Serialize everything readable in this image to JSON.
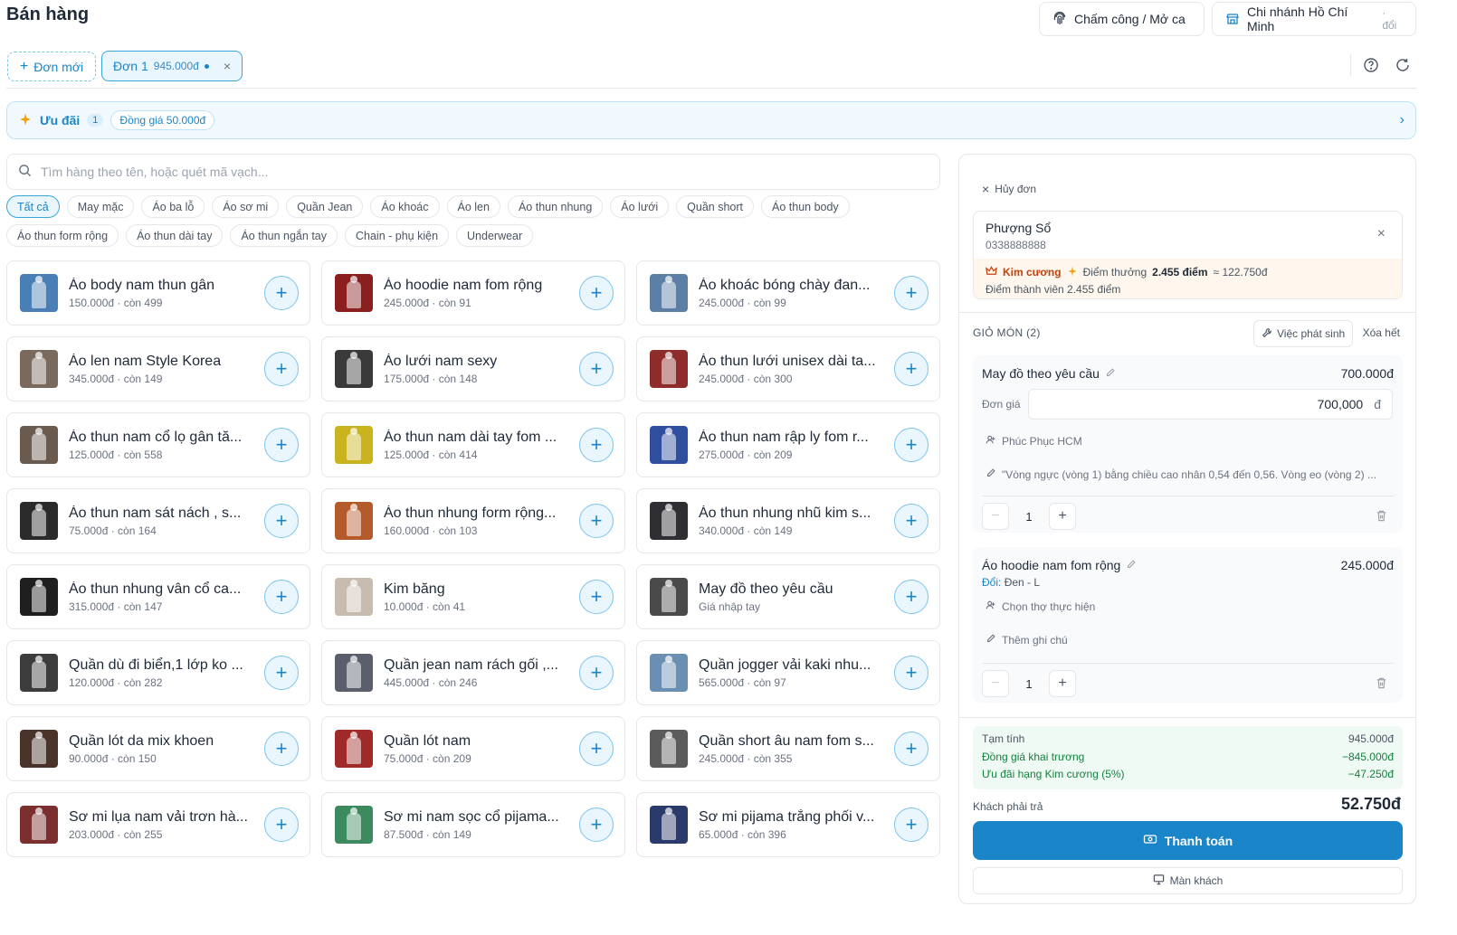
{
  "header": {
    "title": "Bán hàng",
    "attendance_label": "Chấm công / Mở ca",
    "branch_label": "Chi nhánh Hồ Chí Minh",
    "branch_change": "· đổi"
  },
  "orders": {
    "new_label": "Đơn mới",
    "tabs": [
      {
        "label": "Đơn 1",
        "amount": "945.000đ"
      }
    ]
  },
  "promo": {
    "label": "Ưu đãi",
    "count": "1",
    "chip": "Đồng giá 50.000đ"
  },
  "search": {
    "placeholder": "Tìm hàng theo tên, hoặc quét mã vạch..."
  },
  "categories": [
    "Tất cả",
    "May mặc",
    "Áo ba lỗ",
    "Áo sơ mi",
    "Quần Jean",
    "Áo khoác",
    "Áo len",
    "Áo thun nhung",
    "Áo lưới",
    "Quần short",
    "Áo thun body",
    "Áo thun form rộng",
    "Áo thun dài tay",
    "Áo thun ngắn tay",
    "Chain - phụ kiện",
    "Underwear"
  ],
  "active_category": 0,
  "products": [
    {
      "name": "Áo body nam thun gân",
      "meta": "150.000đ · còn 499",
      "thumb": "#4a7fb5"
    },
    {
      "name": "Áo hoodie nam fom rộng",
      "meta": "245.000đ · còn 91",
      "thumb": "#8b1e1e"
    },
    {
      "name": "Áo khoác bóng chày đan...",
      "meta": "245.000đ · còn 99",
      "thumb": "#5b7fa6"
    },
    {
      "name": "Áo len nam Style Korea",
      "meta": "345.000đ · còn 149",
      "thumb": "#7a6a5e"
    },
    {
      "name": "Áo lưới nam sexy",
      "meta": "175.000đ · còn 148",
      "thumb": "#3a3a3a"
    },
    {
      "name": "Áo thun lưới unisex dài ta...",
      "meta": "245.000đ · còn 300",
      "thumb": "#8e2b2b"
    },
    {
      "name": "Áo thun nam cổ lọ gân tă...",
      "meta": "125.000đ · còn 558",
      "thumb": "#6b5b4e"
    },
    {
      "name": "Áo thun nam dài tay fom ...",
      "meta": "125.000đ · còn 414",
      "thumb": "#c9b41e"
    },
    {
      "name": "Áo thun nam rập ly fom r...",
      "meta": "275.000đ · còn 209",
      "thumb": "#2f4f9e"
    },
    {
      "name": "Áo thun nam sát nách , s...",
      "meta": "75.000đ · còn 164",
      "thumb": "#2b2b2b"
    },
    {
      "name": "Áo thun nhung form rộng...",
      "meta": "160.000đ · còn 103",
      "thumb": "#b55a2a"
    },
    {
      "name": "Áo thun nhung nhũ kim s...",
      "meta": "340.000đ · còn 149",
      "thumb": "#2e2e33"
    },
    {
      "name": "Áo thun nhung vân cổ ca...",
      "meta": "315.000đ · còn 147",
      "thumb": "#1f1f1f"
    },
    {
      "name": "Kim băng",
      "meta": "10.000đ · còn 41",
      "thumb": "#c8bcae"
    },
    {
      "name": "May đồ theo yêu cầu",
      "meta": "Giá nhập tay",
      "thumb": "#4a4a4a"
    },
    {
      "name": "Quần dù đi biển,1 lớp ko ...",
      "meta": "120.000đ · còn 282",
      "thumb": "#3c3c3c"
    },
    {
      "name": "Quần jean nam rách gối ,...",
      "meta": "445.000đ · còn 246",
      "thumb": "#5a5f6b"
    },
    {
      "name": "Quần jogger vải kaki nhu...",
      "meta": "565.000đ · còn 97",
      "thumb": "#6b8fb3"
    },
    {
      "name": "Quần lót da mix khoen",
      "meta": "90.000đ · còn 150",
      "thumb": "#4a3328"
    },
    {
      "name": "Quần lót nam",
      "meta": "75.000đ · còn 209",
      "thumb": "#9e2a2a"
    },
    {
      "name": "Quần short âu nam fom s...",
      "meta": "245.000đ · còn 355",
      "thumb": "#5b5b5b"
    },
    {
      "name": "Sơ mi lụa nam vải trơn hà...",
      "meta": "203.000đ · còn 255",
      "thumb": "#7a2e2e"
    },
    {
      "name": "Sơ mi nam sọc cổ pijama...",
      "meta": "87.500đ · còn 149",
      "thumb": "#3d8a5f"
    },
    {
      "name": "Sơ mi pijama trắng phối v...",
      "meta": "65.000đ · còn 396",
      "thumb": "#2a3a6b"
    }
  ],
  "panel": {
    "cancel_label": "Hủy đơn",
    "customer": {
      "name": "Phượng Sổ",
      "phone": "0338888888",
      "tier": "Kim cương",
      "reward_label": "Điểm thưởng",
      "reward_points": "2.455 điểm",
      "reward_value": "≈ 122.750đ",
      "member_points": "Điểm thành viên 2.455 điểm"
    },
    "cart_title": "GIỎ MÓN (2)",
    "task_label": "Việc phát sinh",
    "clear_label": "Xóa hết",
    "items": [
      {
        "name": "May đồ theo yêu cầu",
        "price": "700.000đ",
        "unit_label": "Đơn giá",
        "unit_value": "700,000",
        "currency": "đ",
        "worker": "Phúc Phục HCM",
        "note": "\"Vòng ngực (vòng 1) bằng chiều cao nhân 0,54 đến 0,56. Vòng eo (vòng 2) ...",
        "qty": "1"
      },
      {
        "name": "Áo hoodie nam fom rộng",
        "price": "245.000đ",
        "variant_key": "Đổi:",
        "variant_value": "Đen - L",
        "worker": "Chọn thợ thực hiện",
        "note": "Thêm ghi chú",
        "qty": "1"
      }
    ],
    "summary": [
      {
        "label": "Tạm tính",
        "value": "945.000đ",
        "green": false
      },
      {
        "label": "Đồng giá khai trương",
        "value": "−845.000đ",
        "green": true
      },
      {
        "label": "Ưu đãi hạng Kim cương (5%)",
        "value": "−47.250đ",
        "green": true
      }
    ],
    "pay_label": "Khách phải trả",
    "pay_total": "52.750đ",
    "pay_button": "Thanh toán",
    "customer_screen": "Màn khách"
  },
  "colors": {
    "accent": "#1a85c9",
    "discount": "#15803d",
    "tier": "#c2410c"
  }
}
